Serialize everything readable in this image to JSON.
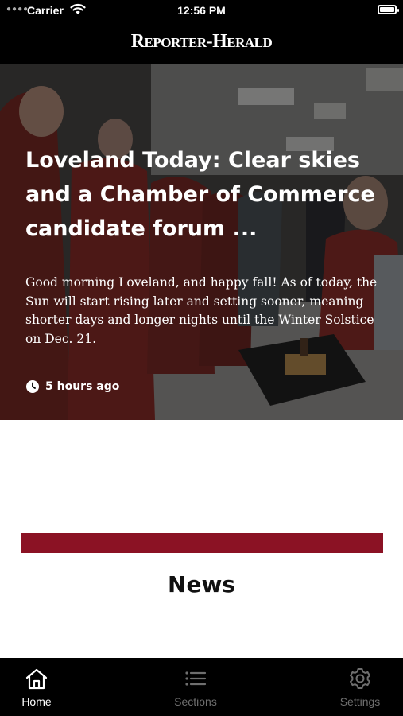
{
  "status_bar": {
    "carrier": "Carrier",
    "time": "12:56 PM"
  },
  "masthead": {
    "logo": "Reporter-Herald"
  },
  "hero": {
    "headline": "Loveland Today: Clear skies and a Chamber of Commerce candidate forum ...",
    "summary": "Good morning Loveland, and happy fall! As of today, the Sun will start rising later and setting sooner, meaning shorter days and longer nights until the Winter Solstice on Dec. 21.",
    "time_ago": "5 hours ago"
  },
  "section": {
    "title": "News",
    "accent_color": "#8b1224"
  },
  "tabbar": {
    "tabs": [
      {
        "label": "Home",
        "icon": "home-icon",
        "active": true
      },
      {
        "label": "Sections",
        "icon": "list-icon",
        "active": false
      },
      {
        "label": "Settings",
        "icon": "gear-icon",
        "active": false
      }
    ]
  }
}
